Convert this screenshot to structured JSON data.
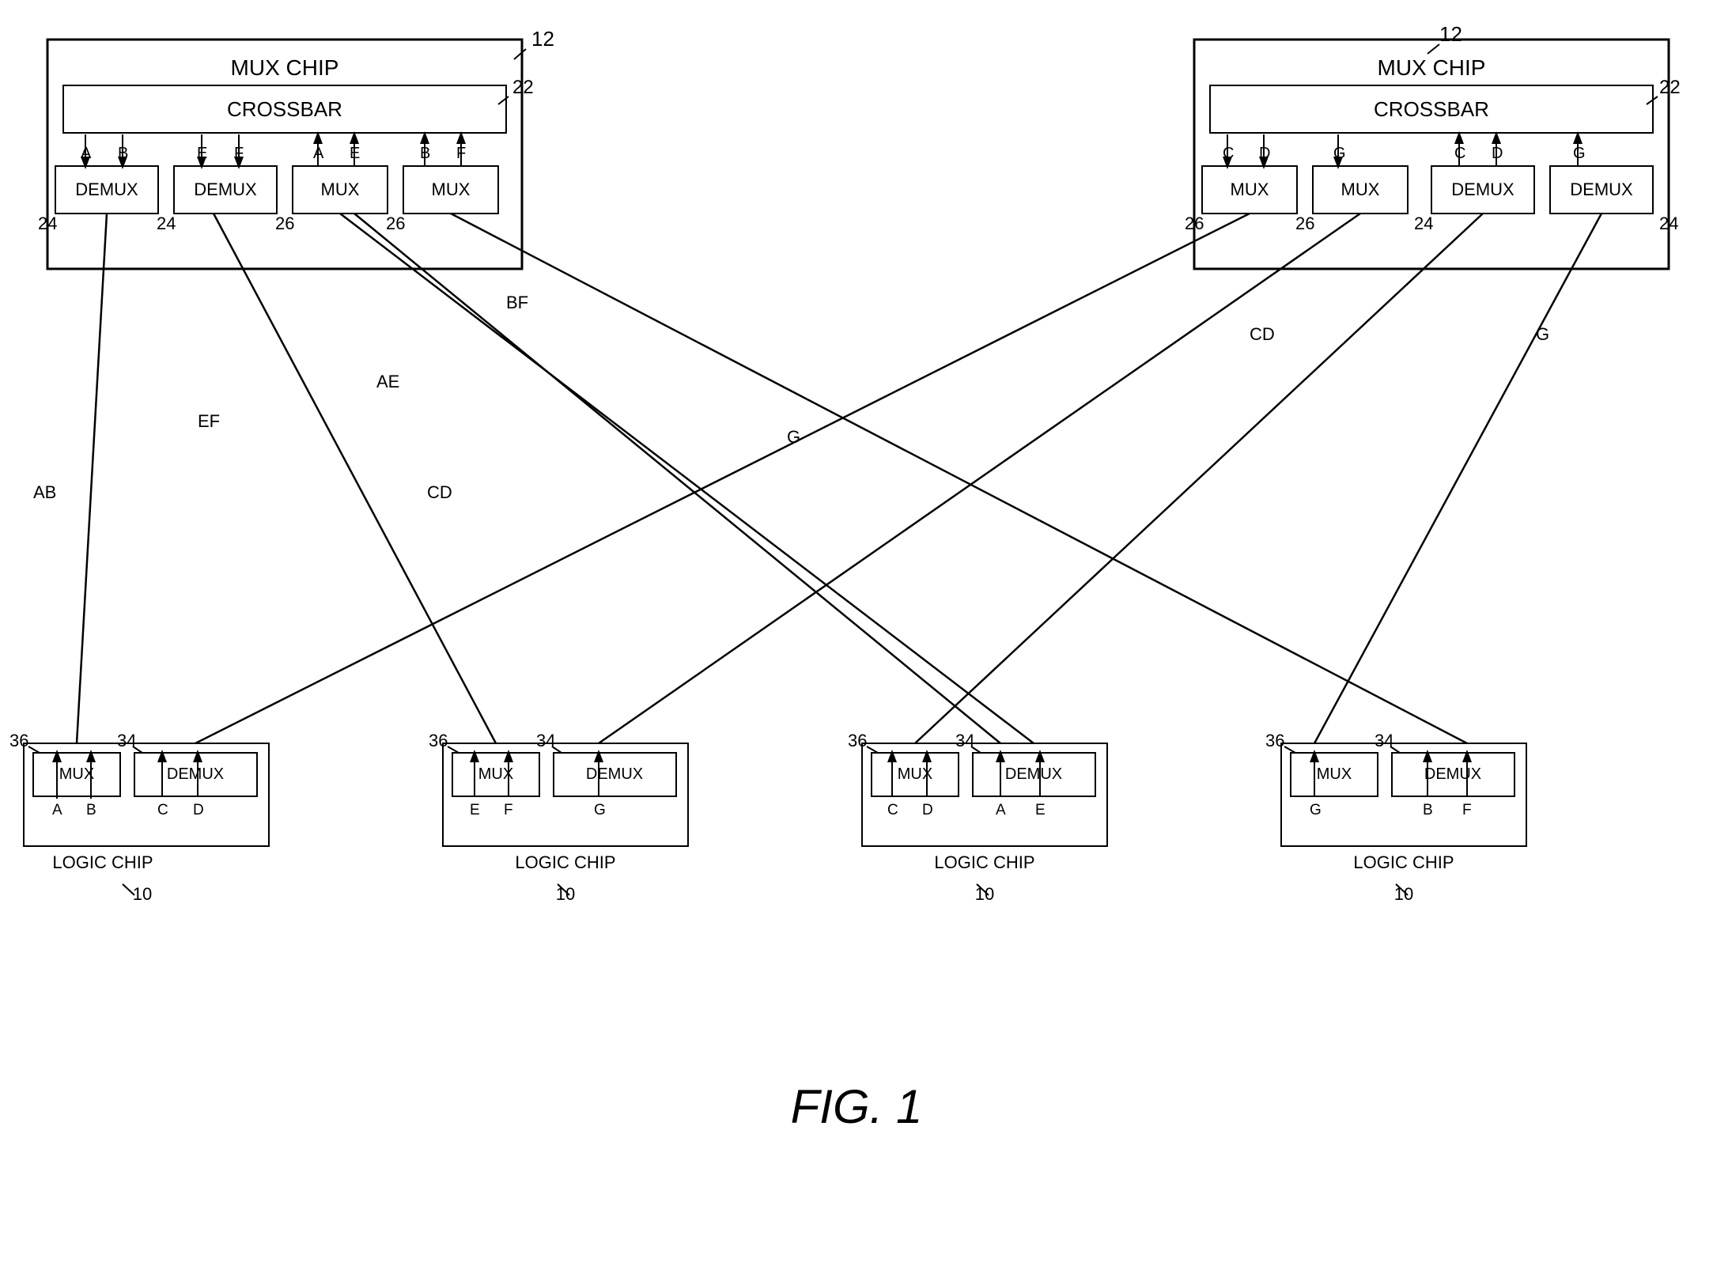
{
  "title": "FIG. 1",
  "diagram": {
    "left_mux_chip": {
      "label": "MUX CHIP",
      "number": "12",
      "crossbar_label": "CROSSBAR",
      "crossbar_number": "22",
      "demux1": {
        "label": "DEMUX",
        "number": "24",
        "signals": [
          "A",
          "B"
        ]
      },
      "demux2": {
        "label": "DEMUX",
        "number": "24",
        "signals": [
          "E",
          "F"
        ]
      },
      "mux1": {
        "label": "MUX",
        "number": "26",
        "signals": [
          "A",
          "E"
        ]
      },
      "mux2": {
        "label": "MUX",
        "number": "26",
        "signals": [
          "B",
          "F"
        ]
      }
    },
    "right_mux_chip": {
      "label": "MUX CHIP",
      "number": "12",
      "crossbar_label": "CROSSBAR",
      "crossbar_number": "22",
      "mux1": {
        "label": "MUX",
        "number": "26",
        "signals": [
          "C",
          "D"
        ]
      },
      "mux2": {
        "label": "MUX",
        "number": "26",
        "signals": [
          "G"
        ]
      },
      "demux1": {
        "label": "DEMUX",
        "number": "24",
        "signals": [
          "C",
          "D"
        ]
      },
      "demux2": {
        "label": "DEMUX",
        "number": "24",
        "signals": [
          "G"
        ]
      }
    },
    "logic_chips": [
      {
        "label": "LOGIC CHIP",
        "number": "10",
        "mux": "36",
        "demux": "34",
        "mux_signals": [
          "A",
          "B"
        ],
        "demux_signals": [
          "C",
          "D"
        ]
      },
      {
        "label": "LOGIC CHIP",
        "number": "10",
        "mux": "36",
        "demux": "34",
        "mux_signals": [
          "E",
          "F"
        ],
        "demux_signals": [
          "G"
        ]
      },
      {
        "label": "LOGIC CHIP",
        "number": "10",
        "mux": "36",
        "demux": "34",
        "mux_signals": [
          "C",
          "D"
        ],
        "demux_signals": [
          "A",
          "E"
        ]
      },
      {
        "label": "LOGIC CHIP",
        "number": "10",
        "mux": "36",
        "demux": "34",
        "mux_signals": [
          "G"
        ],
        "demux_signals": [
          "B",
          "F"
        ]
      }
    ],
    "wire_labels": [
      "AB",
      "EF",
      "AE",
      "CD",
      "BF",
      "G",
      "CD",
      "G"
    ]
  }
}
